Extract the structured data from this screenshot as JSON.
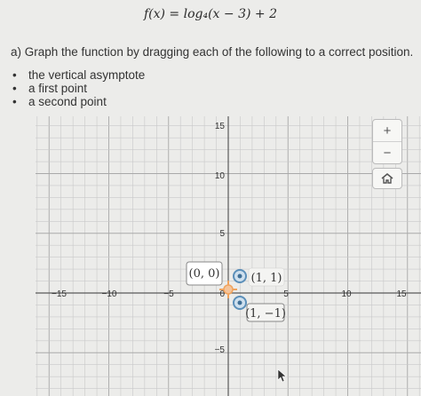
{
  "equation": "f(x) = log₄(x − 3) + 2",
  "instruction": "a) Graph the function by dragging each of the following to a correct position.",
  "tasks": [
    "the vertical asymptote",
    "a first point",
    "a second point"
  ],
  "graph": {
    "x_tick_labels": [
      "−15",
      "−10",
      "−5",
      "0",
      "5",
      "10",
      "15"
    ],
    "y_tick_labels": [
      "15",
      "10",
      "5",
      "−5"
    ],
    "origin_label": "(0, 0)",
    "point_1_label": "(1, 1)",
    "point_2_label": "(1, −1)",
    "asymptote_handle_color": "#f0a35e",
    "point_color": "#5b8fb9",
    "cursor_icon": "arrow-cursor-icon"
  },
  "controls": {
    "zoom_in": "+",
    "zoom_out": "−",
    "home_icon": "home-icon"
  }
}
